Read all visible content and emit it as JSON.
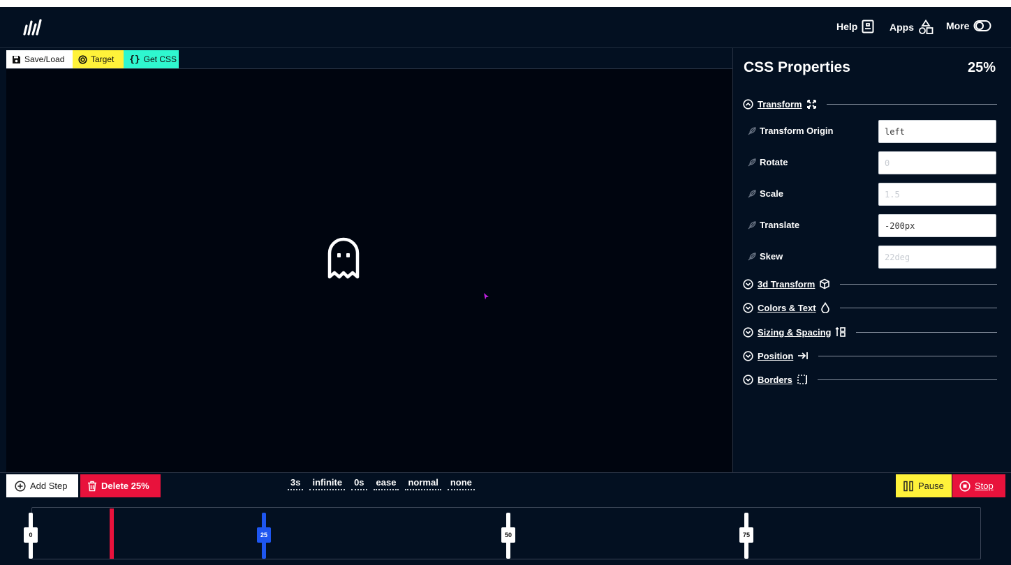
{
  "topbar": {
    "help_label": "Help",
    "apps_label": "Apps",
    "more_label": "More"
  },
  "stage_toolbar": {
    "save_load_label": "Save/Load",
    "target_label": "Target",
    "get_css_label": "Get CSS"
  },
  "panel": {
    "title": "CSS Properties",
    "percent": "25%",
    "sections": {
      "transform": "Transform",
      "transform_3d": "3d Transform",
      "colors_text": "Colors & Text",
      "sizing_spacing": "Sizing & Spacing",
      "position": "Position",
      "borders": "Borders"
    },
    "props": [
      {
        "label": "Transform Origin",
        "value": "left",
        "placeholder": ""
      },
      {
        "label": "Rotate",
        "value": "",
        "placeholder": "0"
      },
      {
        "label": "Scale",
        "value": "",
        "placeholder": "1.5"
      },
      {
        "label": "Translate",
        "value": "-200px",
        "placeholder": ""
      },
      {
        "label": "Skew",
        "value": "",
        "placeholder": "22deg"
      }
    ]
  },
  "bottombar": {
    "add_step_label": "Add Step",
    "delete_label": "Delete 25%",
    "animation": {
      "duration": "3s",
      "iteration": "infinite",
      "delay": "0s",
      "timing": "ease",
      "direction": "normal",
      "fill": "none"
    },
    "pause_label": "Pause",
    "stop_label": "Stop"
  },
  "timeline": {
    "steps": [
      "0",
      "25",
      "50",
      "75"
    ],
    "active_step": "25",
    "playhead_percent": 8.5
  },
  "colors": {
    "background": "#031021",
    "stage": "#00050f",
    "target_yellow": "#fff23a",
    "getcss_teal": "#2ff7cf",
    "danger_red": "#e8123c",
    "active_blue": "#1e56f0"
  }
}
